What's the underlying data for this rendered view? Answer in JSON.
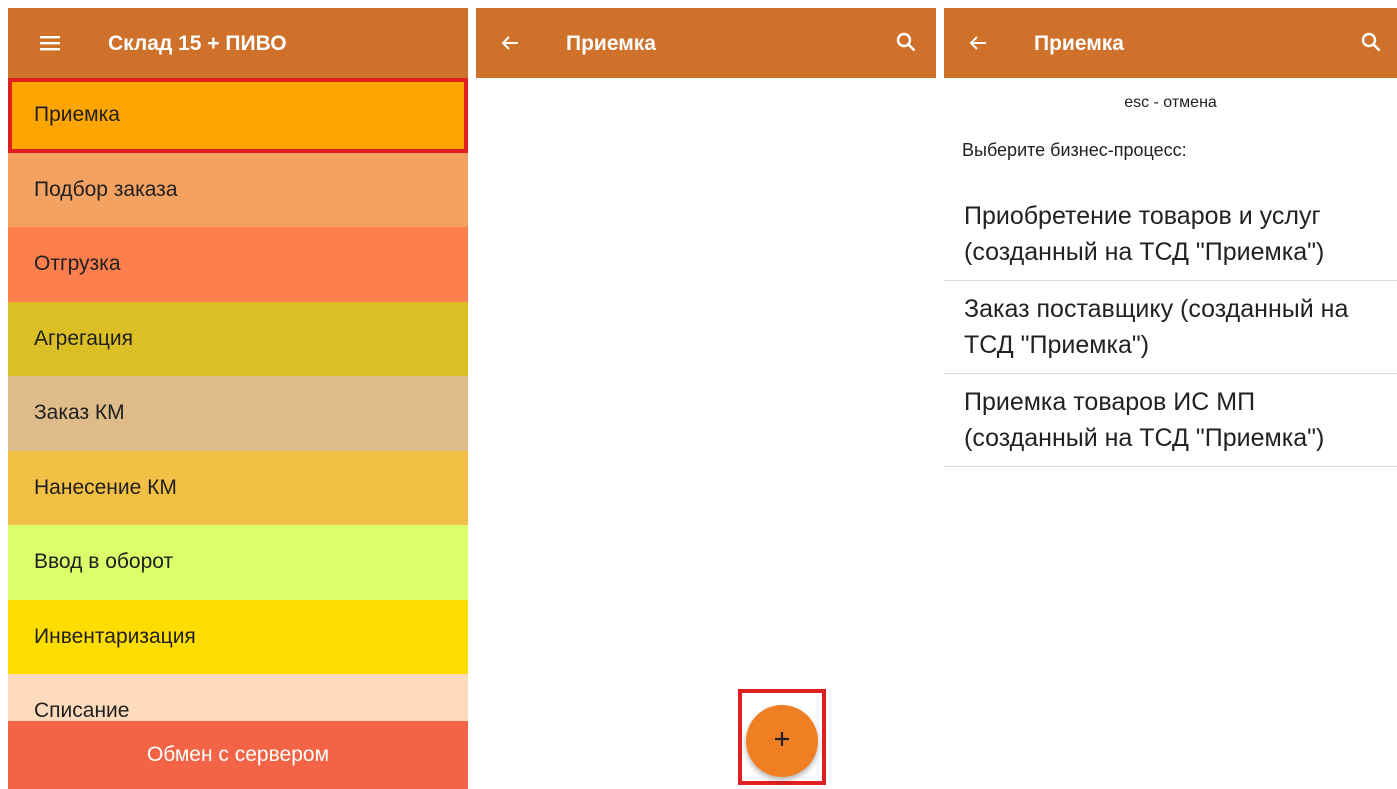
{
  "warehouse_screen": {
    "title": "Склад 15 + ПИВО",
    "menu_icon": "menu-icon",
    "items": [
      {
        "label": "Приемка",
        "color": "#ffa500"
      },
      {
        "label": "Подбор заказа",
        "color": "#f4a261"
      },
      {
        "label": "Отгрузка",
        "color": "#fe7f4e"
      },
      {
        "label": "Агрегация",
        "color": "#dcbf24"
      },
      {
        "label": "Заказ КМ",
        "color": "#debb88"
      },
      {
        "label": "Нанесение КМ",
        "color": "#f2c045"
      },
      {
        "label": "Ввод в оборот",
        "color": "#dbfe6b"
      },
      {
        "label": "Инвентаризация",
        "color": "#fedd00"
      },
      {
        "label": "Списание",
        "color": "#ffdbbd"
      }
    ],
    "server_button": "Обмен с сервером"
  },
  "receipt_screen": {
    "title": "Приемка",
    "back_icon": "arrow-left-icon",
    "search_icon": "search-icon",
    "fab_icon": "plus-icon"
  },
  "process_screen": {
    "title": "Приемка",
    "hint": "esc - отмена",
    "prompt": "Выберите бизнес-процесс:",
    "processes": [
      "Приобретение товаров и услуг (созданный на ТСД \"Приемка\")",
      "Заказ поставщику (созданный на ТСД \"Приемка\")",
      "Приемка товаров ИС МП (созданный на ТСД \"Приемка\")"
    ]
  },
  "colors": {
    "app_bar": "#cf702b",
    "highlight_frame": "#e02020",
    "server_button": "#f26445",
    "fab": "#f07f24"
  }
}
